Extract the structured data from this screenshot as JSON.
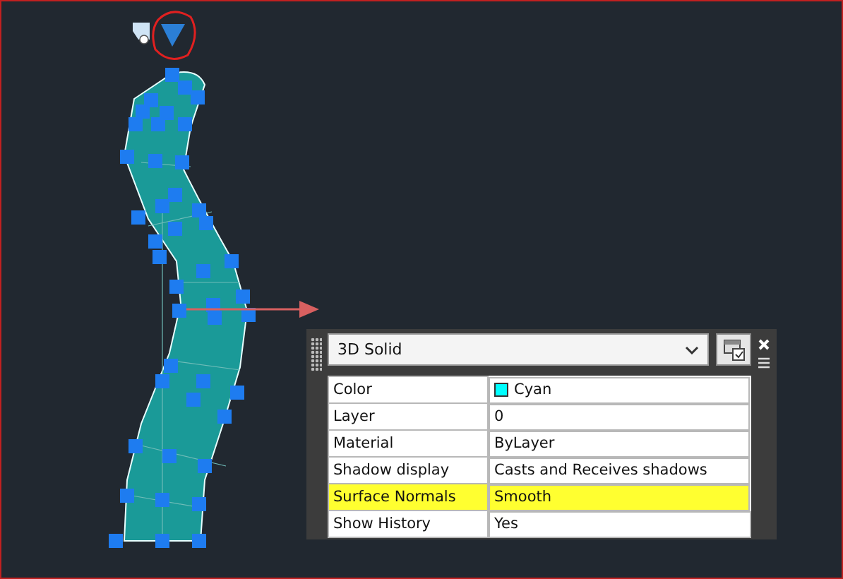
{
  "palette": {
    "object_type": "3D Solid",
    "properties": [
      {
        "label": "Color",
        "value": "Cyan",
        "color": "#00ffff",
        "highlighted": false
      },
      {
        "label": "Layer",
        "value": "0",
        "highlighted": false
      },
      {
        "label": "Material",
        "value": "ByLayer",
        "highlighted": false
      },
      {
        "label": "Shadow display",
        "value": "Casts and Receives shadows",
        "highlighted": false
      },
      {
        "label": "Surface Normals",
        "value": "Smooth",
        "highlighted": true
      },
      {
        "label": "Show History",
        "value": "Yes",
        "highlighted": false
      }
    ]
  }
}
